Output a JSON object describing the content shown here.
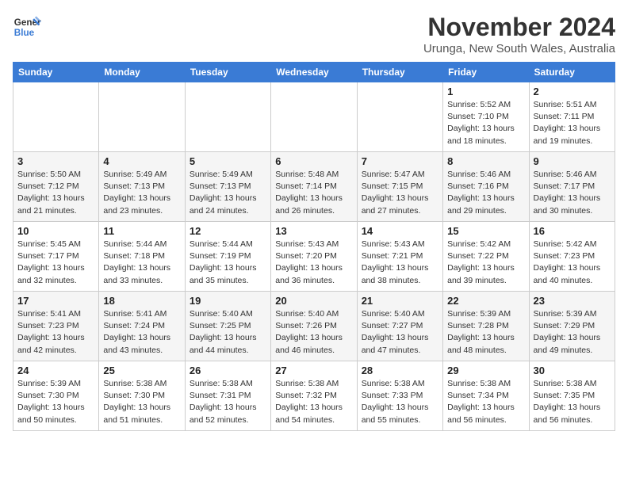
{
  "logo": {
    "line1": "General",
    "line2": "Blue"
  },
  "title": "November 2024",
  "location": "Urunga, New South Wales, Australia",
  "days_of_week": [
    "Sunday",
    "Monday",
    "Tuesday",
    "Wednesday",
    "Thursday",
    "Friday",
    "Saturday"
  ],
  "weeks": [
    [
      {
        "day": "",
        "info": ""
      },
      {
        "day": "",
        "info": ""
      },
      {
        "day": "",
        "info": ""
      },
      {
        "day": "",
        "info": ""
      },
      {
        "day": "",
        "info": ""
      },
      {
        "day": "1",
        "info": "Sunrise: 5:52 AM\nSunset: 7:10 PM\nDaylight: 13 hours\nand 18 minutes."
      },
      {
        "day": "2",
        "info": "Sunrise: 5:51 AM\nSunset: 7:11 PM\nDaylight: 13 hours\nand 19 minutes."
      }
    ],
    [
      {
        "day": "3",
        "info": "Sunrise: 5:50 AM\nSunset: 7:12 PM\nDaylight: 13 hours\nand 21 minutes."
      },
      {
        "day": "4",
        "info": "Sunrise: 5:49 AM\nSunset: 7:13 PM\nDaylight: 13 hours\nand 23 minutes."
      },
      {
        "day": "5",
        "info": "Sunrise: 5:49 AM\nSunset: 7:13 PM\nDaylight: 13 hours\nand 24 minutes."
      },
      {
        "day": "6",
        "info": "Sunrise: 5:48 AM\nSunset: 7:14 PM\nDaylight: 13 hours\nand 26 minutes."
      },
      {
        "day": "7",
        "info": "Sunrise: 5:47 AM\nSunset: 7:15 PM\nDaylight: 13 hours\nand 27 minutes."
      },
      {
        "day": "8",
        "info": "Sunrise: 5:46 AM\nSunset: 7:16 PM\nDaylight: 13 hours\nand 29 minutes."
      },
      {
        "day": "9",
        "info": "Sunrise: 5:46 AM\nSunset: 7:17 PM\nDaylight: 13 hours\nand 30 minutes."
      }
    ],
    [
      {
        "day": "10",
        "info": "Sunrise: 5:45 AM\nSunset: 7:17 PM\nDaylight: 13 hours\nand 32 minutes."
      },
      {
        "day": "11",
        "info": "Sunrise: 5:44 AM\nSunset: 7:18 PM\nDaylight: 13 hours\nand 33 minutes."
      },
      {
        "day": "12",
        "info": "Sunrise: 5:44 AM\nSunset: 7:19 PM\nDaylight: 13 hours\nand 35 minutes."
      },
      {
        "day": "13",
        "info": "Sunrise: 5:43 AM\nSunset: 7:20 PM\nDaylight: 13 hours\nand 36 minutes."
      },
      {
        "day": "14",
        "info": "Sunrise: 5:43 AM\nSunset: 7:21 PM\nDaylight: 13 hours\nand 38 minutes."
      },
      {
        "day": "15",
        "info": "Sunrise: 5:42 AM\nSunset: 7:22 PM\nDaylight: 13 hours\nand 39 minutes."
      },
      {
        "day": "16",
        "info": "Sunrise: 5:42 AM\nSunset: 7:23 PM\nDaylight: 13 hours\nand 40 minutes."
      }
    ],
    [
      {
        "day": "17",
        "info": "Sunrise: 5:41 AM\nSunset: 7:23 PM\nDaylight: 13 hours\nand 42 minutes."
      },
      {
        "day": "18",
        "info": "Sunrise: 5:41 AM\nSunset: 7:24 PM\nDaylight: 13 hours\nand 43 minutes."
      },
      {
        "day": "19",
        "info": "Sunrise: 5:40 AM\nSunset: 7:25 PM\nDaylight: 13 hours\nand 44 minutes."
      },
      {
        "day": "20",
        "info": "Sunrise: 5:40 AM\nSunset: 7:26 PM\nDaylight: 13 hours\nand 46 minutes."
      },
      {
        "day": "21",
        "info": "Sunrise: 5:40 AM\nSunset: 7:27 PM\nDaylight: 13 hours\nand 47 minutes."
      },
      {
        "day": "22",
        "info": "Sunrise: 5:39 AM\nSunset: 7:28 PM\nDaylight: 13 hours\nand 48 minutes."
      },
      {
        "day": "23",
        "info": "Sunrise: 5:39 AM\nSunset: 7:29 PM\nDaylight: 13 hours\nand 49 minutes."
      }
    ],
    [
      {
        "day": "24",
        "info": "Sunrise: 5:39 AM\nSunset: 7:30 PM\nDaylight: 13 hours\nand 50 minutes."
      },
      {
        "day": "25",
        "info": "Sunrise: 5:38 AM\nSunset: 7:30 PM\nDaylight: 13 hours\nand 51 minutes."
      },
      {
        "day": "26",
        "info": "Sunrise: 5:38 AM\nSunset: 7:31 PM\nDaylight: 13 hours\nand 52 minutes."
      },
      {
        "day": "27",
        "info": "Sunrise: 5:38 AM\nSunset: 7:32 PM\nDaylight: 13 hours\nand 54 minutes."
      },
      {
        "day": "28",
        "info": "Sunrise: 5:38 AM\nSunset: 7:33 PM\nDaylight: 13 hours\nand 55 minutes."
      },
      {
        "day": "29",
        "info": "Sunrise: 5:38 AM\nSunset: 7:34 PM\nDaylight: 13 hours\nand 56 minutes."
      },
      {
        "day": "30",
        "info": "Sunrise: 5:38 AM\nSunset: 7:35 PM\nDaylight: 13 hours\nand 56 minutes."
      }
    ]
  ]
}
